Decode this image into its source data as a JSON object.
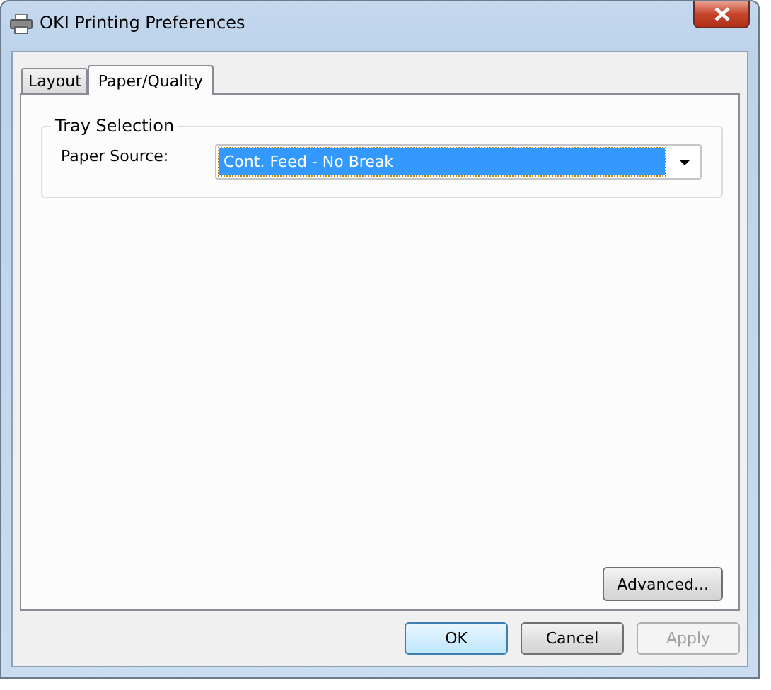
{
  "window": {
    "title": "OKI Printing Preferences"
  },
  "tabs": [
    {
      "label": "Layout",
      "selected": false
    },
    {
      "label": "Paper/Quality",
      "selected": true
    }
  ],
  "tray_selection": {
    "title": "Tray Selection",
    "paper_source": {
      "label": "Paper Source:",
      "value": "Cont. Feed - No Break",
      "focused": true
    }
  },
  "advanced_button": "Advanced...",
  "buttons": [
    {
      "label": "OK",
      "default": true,
      "disabled": false
    },
    {
      "label": "Cancel",
      "default": false,
      "disabled": false
    },
    {
      "label": "Apply",
      "default": false,
      "disabled": true
    }
  ]
}
